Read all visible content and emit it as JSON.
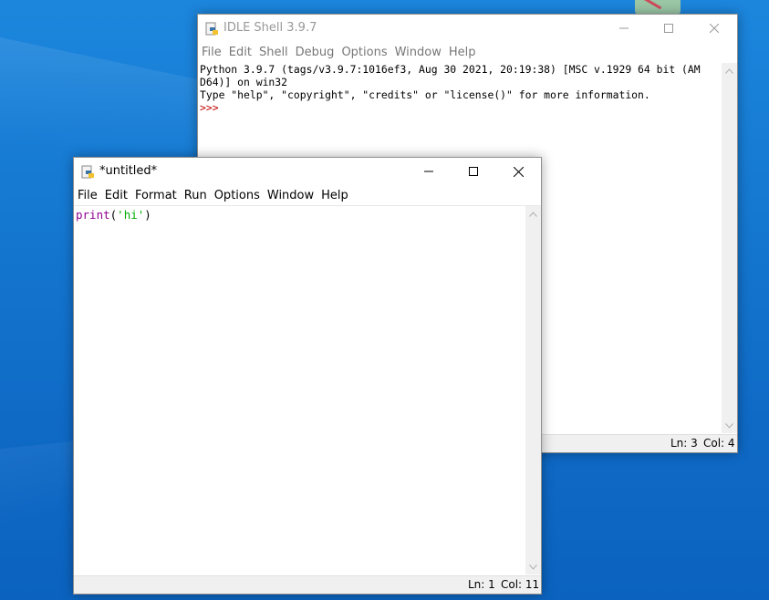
{
  "shell": {
    "title": "IDLE Shell 3.9.7",
    "menu": [
      "File",
      "Edit",
      "Shell",
      "Debug",
      "Options",
      "Window",
      "Help"
    ],
    "lines": [
      "Python 3.9.7 (tags/v3.9.7:1016ef3, Aug 30 2021, 20:19:38) [MSC v.1929 64 bit (AM",
      "D64)] on win32",
      "Type \"help\", \"copyright\", \"credits\" or \"license()\" for more information."
    ],
    "prompt": ">>>",
    "status_ln": "Ln: 3",
    "status_col": "Col: 4"
  },
  "editor": {
    "title": "*untitled*",
    "menu": [
      "File",
      "Edit",
      "Format",
      "Run",
      "Options",
      "Window",
      "Help"
    ],
    "code_func": "print",
    "code_open": "(",
    "code_string": "'hi'",
    "code_close": ")",
    "status_ln": "Ln: 1",
    "status_col": "Col: 11"
  },
  "colors": {
    "builtin": "#900090",
    "string": "#00aa00",
    "prompt": "#c00000"
  },
  "icons": {
    "app": "python-idle-icon",
    "minimize": "minimize-icon",
    "maximize": "maximize-icon",
    "close": "close-icon",
    "scroll_up": "chevron-up-icon",
    "scroll_down": "chevron-down-icon"
  }
}
